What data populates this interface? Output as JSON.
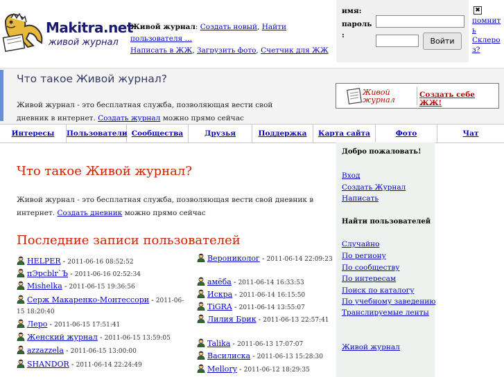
{
  "header": {
    "logo_brand": "Makitra.net",
    "logo_tagline": "живой журнал",
    "section_label": "Живой журнал",
    "links": [
      "Создать новый",
      "Найти пользователя …",
      "Написать в ЖЖ",
      "Загрузить фото",
      "Счетчик для ЖЖ"
    ]
  },
  "login": {
    "name_label": "имя:",
    "password_label": "пароль",
    "password_label_colon": ":",
    "submit_label": "Войти",
    "remember_label": "помнить",
    "sclerosis_link": "Склероз?"
  },
  "intro": {
    "title": "Что такое Живой журнал?",
    "text_before": "Живой журнал - это бесплатная служба, позволяющая вести свой дневник в интернет.",
    "link": "Создать журнал",
    "text_after": "можно прямо сейчас",
    "promo_logo": "Живой журнал",
    "promo_link": "Создать себе ЖЖ!"
  },
  "nav": [
    "Интересы",
    "Пользователи",
    "Сообщества",
    "Друзья",
    "Поддержка",
    "Карта сайта",
    "Фото",
    "Чат"
  ],
  "main": {
    "title": "Что такое Живой журнал?",
    "text_before": "Живой журнал - это бесплатная служба, позволяющая вести свой дневник в интернет.",
    "link": "Создать дневник",
    "text_after": "можно прямо сейчас",
    "recent_title": "Последние записи пользователей"
  },
  "recent_left": [
    {
      "user": "HELPER",
      "date": "2011-06-16 08:52:52"
    },
    {
      "user": "пЭрсblr`Ъ",
      "date": "2011-06-16 02:52:34"
    },
    {
      "user": "Mishelka",
      "date": "2011-06-15 19:36:56"
    },
    {
      "user": "Серж Макаренко-Монтессори",
      "date": "2011-06-15 18:20:40"
    },
    {
      "user": "Лерo",
      "date": "2011-06-15 17:51:41"
    },
    {
      "user": "Женский журнал",
      "date": "2011-06-15 13:59:05"
    },
    {
      "user": "azzazzela",
      "date": "2011-06-15 13:00:00"
    },
    {
      "user": "SHANDOR",
      "date": "2011-06-14 22:24:49"
    }
  ],
  "recent_right": [
    {
      "user": "Верониколог",
      "date": "2011-06-14 22:09:23"
    },
    {
      "user": "амёба",
      "date": "2011-06-14 16:33:53"
    },
    {
      "user": "Искра",
      "date": "2011-06-14 16:15:50"
    },
    {
      "user": "TiGRA",
      "date": "2011-06-14 13:55:07"
    },
    {
      "user": "Лилия Брик",
      "date": "2011-06-13 22:57:41"
    },
    {
      "user": "Talika",
      "date": "2011-06-13 17:07:07"
    },
    {
      "user": "Василиска",
      "date": "2011-06-13 15:28:30"
    },
    {
      "user": "Mellory",
      "date": "2011-06-12 18:29:35"
    }
  ],
  "sidebar": {
    "welcome": "Добро пожаловать!",
    "links1": [
      "Вход",
      "Создать Журнал",
      "Написать"
    ],
    "find_title": "Найти пользователей",
    "links2": [
      "Случайно",
      "По региону",
      "По сообществу",
      "По интересам",
      "Поиск по каталогу",
      "По учебному заведению",
      "Транслируемые ленты"
    ],
    "footer_link": "Живой журнал"
  },
  "colors": {
    "link": "#0000cc",
    "heading_red": "#cc2200",
    "band_bar": "#6a8fd0",
    "sidebar_bg": "#eef2ee"
  }
}
